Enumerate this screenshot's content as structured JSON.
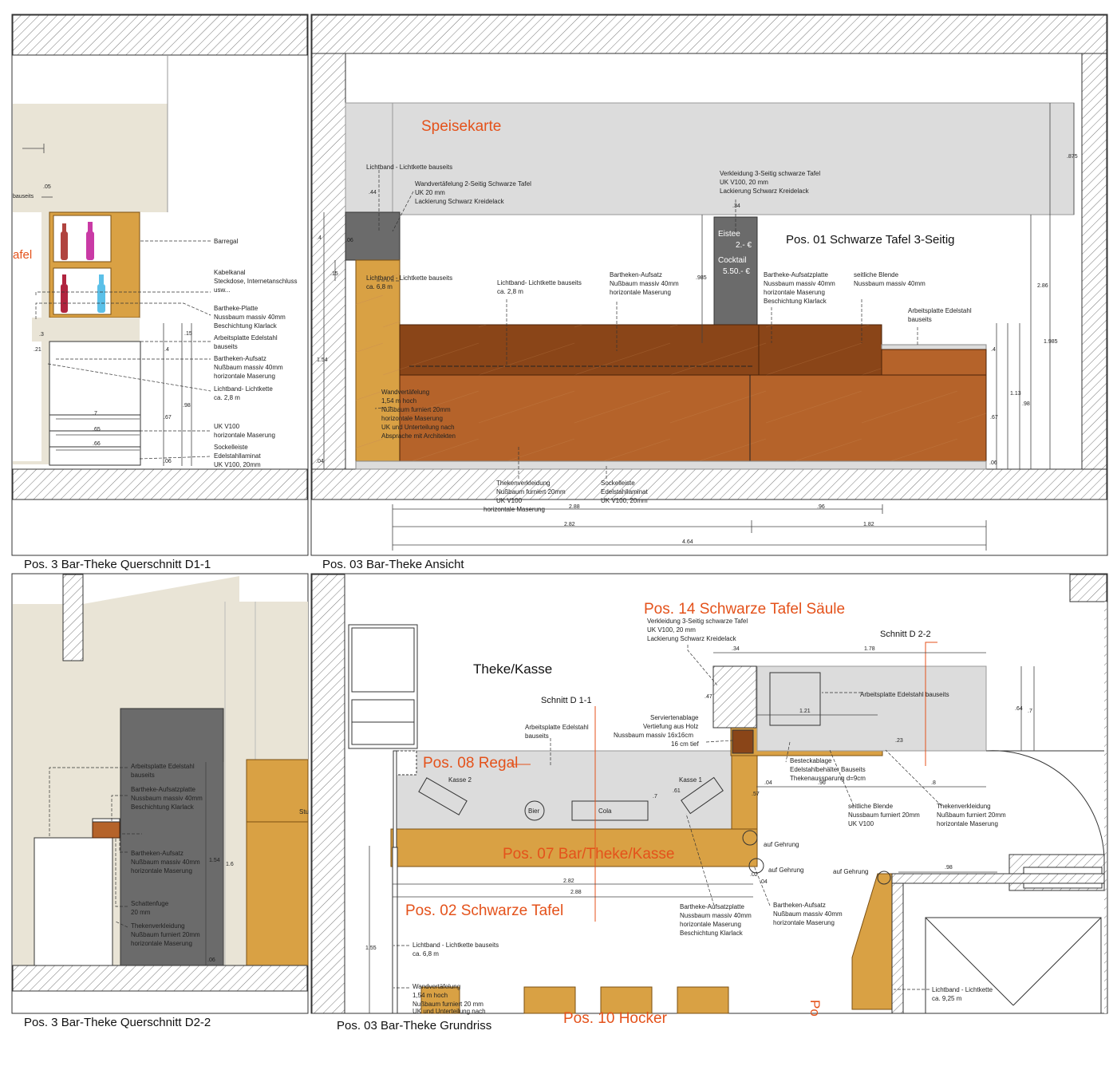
{
  "captions": {
    "p1": "Pos. 3  Bar-Theke Querschnitt D1-1",
    "p2": "Pos. 03  Bar-Theke Ansicht",
    "p3": "Pos. 3  Bar-Theke Querschnitt D2-2",
    "p4": "Pos. 03 Bar-Theke Grundriss"
  },
  "colors": {
    "wood": "#b5632a",
    "wood_dark": "#8a4518",
    "oak": "#d9a144",
    "grey_board": "#6b6b6b",
    "light_grey": "#dcdcdc",
    "beige": "#e9e4d6",
    "orange_text": "#e4521b"
  },
  "d1": {
    "label_fragment": "afel",
    "bauseits_fragment": "bauseits",
    "dims": {
      "d05": ".05",
      "d3": ".3",
      "d21": ".21",
      "d15": ".15",
      "d4": ".4",
      "d98": ".98",
      "d67": ".67",
      "d7": ".7",
      "d65": ".65",
      "d66": ".66",
      "d06": ".06"
    },
    "notes": {
      "barregal": "Barregal",
      "kabel": [
        "Kabelkanal",
        "Steckdose, Internetanschluss",
        "usw..."
      ],
      "platte": [
        "Bartheke-Platte",
        "Nussbaum massiv 40mm",
        "Beschichtung Klarlack"
      ],
      "arbeitsplatte": [
        "Arbeitsplatte Edelstahl",
        "bauseits"
      ],
      "aufsatz": [
        "Bartheken-Aufsatz",
        "Nußbaum massiv 40mm",
        "horizontale Maserung"
      ],
      "lichtband": [
        "Lichtband- Lichtkette",
        "ca. 2,8 m"
      ],
      "uk": [
        "UK V100",
        "horizontale Maserung"
      ],
      "sockel": [
        "Sockelleiste",
        "Edelstahllaminat",
        "UK V100, 20mm"
      ]
    }
  },
  "d2": {
    "speisekarte": "Speisekarte",
    "pos01": "Pos. 01  Schwarze Tafel 3-Seitig",
    "column_text": [
      "Eistee",
      "2.- €",
      "Cocktail",
      "5.50.- €"
    ],
    "dims": {
      "d44": ".44",
      "d34": ".34",
      "d875": ".875",
      "d286": "2.86",
      "d1985": "1.985",
      "d985": ".985",
      "d4": ".4",
      "d15": ".15",
      "d154": "1.54",
      "d04": ".04",
      "d06": ".06",
      "d4b": ".4",
      "d113": "1.13",
      "d98": ".98",
      "d67": ".67",
      "d06b": ".06",
      "d288": "2.88",
      "d96": ".96",
      "d282": "2.82",
      "d182": "1.82",
      "d464": "4.64"
    },
    "notes": {
      "lichtband_top": "Lichtband - Lichtkette bauseits",
      "wandverk": [
        "Wandvertäfelung 2-Seitig Schwarze Tafel",
        "UK 20 mm",
        "Lackierung Schwarz Kreidelack"
      ],
      "verkleidung": [
        "Verkleidung 3-Seitig schwarze Tafel",
        "UK V100, 20 mm",
        "Lackierung Schwarz Kreidelack"
      ],
      "lichtkette_left": [
        "Lichtband - Lichtkette bauseits",
        "ca. 6,8 m"
      ],
      "lichtband_mid": [
        "Lichtband- Lichtkette bauseits",
        "ca. 2,8 m"
      ],
      "aufsatz": [
        "Bartheken-Aufsatz",
        "Nußbaum massiv 40mm",
        "horizontale Maserung"
      ],
      "aufsatzplatte": [
        "Bartheke-Aufsatzplatte",
        "Nussbaum massiv 40mm",
        "horizontale Maserung",
        "Beschichtung Klarlack"
      ],
      "blende": [
        "seitliche Blende",
        "Nussbaum massiv 40mm"
      ],
      "arbeitsplatte": [
        "Arbeitsplatte Edelstahl",
        "bauseits"
      ],
      "wandvertaefelung": [
        "Wandvertäfelung",
        "1,54 m hoch",
        "Nußbaum furniert 20mm",
        "horizontale Maserung",
        "UK und Unterteilung nach",
        "Absprache mit Architekten"
      ],
      "thekenverk": [
        "Thekenverkleidung",
        "Nußbaum furniert 20mm",
        "UK V100",
        "horizontale Maserung"
      ],
      "sockel": [
        "Sockelleiste",
        "Edelstahllaminat",
        "UK V100, 20mm"
      ]
    }
  },
  "d3": {
    "notes": {
      "arbeitsplatte": [
        "Arbeitsplatte Edelstahl",
        "bauseits"
      ],
      "aufsatzplatte": [
        "Bartheke-Aufsatzplatte",
        "Nussbaum massiv 40mm",
        "Beschichtung Klarlack"
      ],
      "aufsatz": [
        "Bartheken-Aufsatz",
        "Nußbaum massiv 40mm",
        "horizontale Maserung"
      ],
      "schattenfuge": [
        "Schattenfuge",
        "20 mm"
      ],
      "thekenverk": [
        "Thekenverkleidung",
        "Nußbaum furniert 20mm",
        "horizontale Maserung"
      ]
    },
    "dims": {
      "d154": "1.54",
      "d16": "1.6",
      "d06": ".06"
    },
    "fragment": "Stu"
  },
  "d4": {
    "pos14": "Pos. 14 Schwarze Tafel Säule",
    "pos08": "Pos. 08 Regal",
    "pos07": "Pos. 07 Bar/Theke/Kasse",
    "pos02": "Pos. 02 Schwarze Tafel",
    "pos10": "Pos. 10 Hocker",
    "pos_frag": "Po",
    "theke_kasse": "Theke/Kasse",
    "schnitt_d11": "Schnitt D 1-1",
    "schnitt_d22": "Schnitt D 2-2",
    "kasse1": "Kasse 1",
    "kasse2": "Kasse 2",
    "bier": "Bier",
    "cola": "Cola",
    "gehrung1": "auf Gehrung",
    "gehrung2": "auf Gehrung",
    "gehrung3": "auf Gehrung",
    "dims": {
      "d34": ".34",
      "d178": "1.78",
      "d47": ".47",
      "d121": "1.21",
      "d64": ".64",
      "d7": ".7",
      "d23": ".23",
      "d04": ".04",
      "d57": ".57",
      "d96": ".96",
      "d8": ".8",
      "d7b": ".7",
      "d61": ".61",
      "d98": ".98",
      "d282": "2.82",
      "d288": "2.88",
      "d02": ".02",
      "d04b": ".04",
      "d155": "1.55"
    },
    "notes": {
      "verkleidung": [
        "Verkleidung 3-Seitig schwarze Tafel",
        "UK V100, 20 mm",
        "Lackierung Schwarz Kreidelack"
      ],
      "arbeitsplatte_right": "Arbeitsplatte Edelstahl bauseits",
      "arbeitsplatte_left": [
        "Arbeitsplatte Edelstahl",
        "bauseits"
      ],
      "servier": [
        "Serviertenablage",
        "Vertiefung aus Holz",
        "Nussbaum massiv 16x16cm",
        "16 cm tief"
      ],
      "besteck": [
        "Besteckablage",
        "Edelstahlbehälter Bauseits",
        "Thekenaussparung d=9cm"
      ],
      "blende": [
        "seitliche Blende",
        "Nussbaum furniert 20mm",
        "UK V100"
      ],
      "thekenverk": [
        "Thekenverkleidung",
        "Nußbaum furniert 20mm",
        "horizontale Maserung"
      ],
      "aufsatzplatte": [
        "Bartheke-Aufsatzplatte",
        "Nussbaum massiv 40mm",
        "horizontale Maserung",
        "Beschichtung Klarlack"
      ],
      "aufsatz": [
        "Bartheken-Aufsatz",
        "Nußbaum massiv 40mm",
        "horizontale Maserung"
      ],
      "lichtband_left": [
        "Lichtband - Lichtkette bauseits",
        "ca. 6,8 m"
      ],
      "wand": [
        "Wandvertäfelung",
        "1,54 m hoch",
        "Nußbaum furniert 20 mm",
        "UK und Unterteilung nach"
      ],
      "lichtband_right": [
        "Lichtband - Lichtkette",
        "ca. 9,25 m"
      ]
    }
  }
}
